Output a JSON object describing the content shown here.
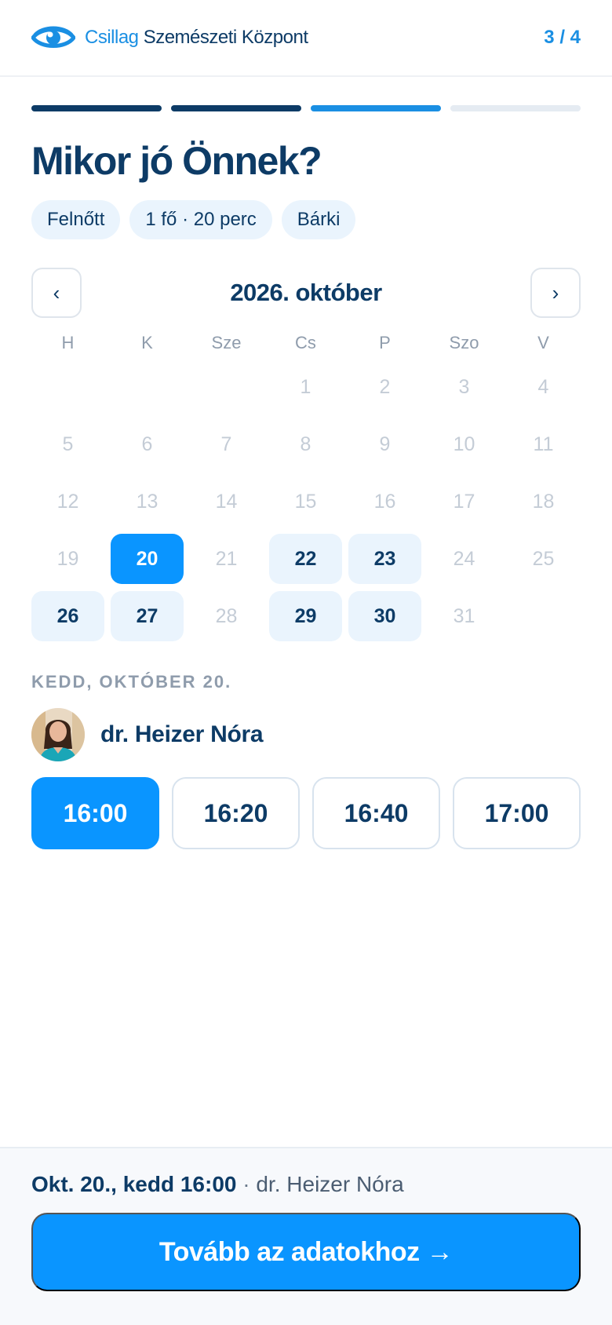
{
  "header": {
    "brand_highlight": "Csillag",
    "brand_rest": "Szemészeti Központ",
    "step": "3 / 4"
  },
  "progress": {
    "total_steps": 4,
    "current_step": 3
  },
  "title": "Mikor jó Önnek?",
  "chips": [
    "Felnőtt",
    "1 fő · 20 perc",
    "Bárki"
  ],
  "calendar": {
    "month_label": "2026. október",
    "prev_icon": "‹",
    "next_icon": "›",
    "weekdays": [
      "H",
      "K",
      "Sze",
      "Cs",
      "P",
      "Szo",
      "V"
    ],
    "leading_empty": 3,
    "days": [
      {
        "d": "1",
        "s": "disabled"
      },
      {
        "d": "2",
        "s": "disabled"
      },
      {
        "d": "3",
        "s": "disabled"
      },
      {
        "d": "4",
        "s": "disabled"
      },
      {
        "d": "5",
        "s": "disabled"
      },
      {
        "d": "6",
        "s": "disabled"
      },
      {
        "d": "7",
        "s": "disabled"
      },
      {
        "d": "8",
        "s": "disabled"
      },
      {
        "d": "9",
        "s": "disabled"
      },
      {
        "d": "10",
        "s": "disabled"
      },
      {
        "d": "11",
        "s": "disabled"
      },
      {
        "d": "12",
        "s": "disabled"
      },
      {
        "d": "13",
        "s": "disabled"
      },
      {
        "d": "14",
        "s": "disabled"
      },
      {
        "d": "15",
        "s": "disabled"
      },
      {
        "d": "16",
        "s": "disabled"
      },
      {
        "d": "17",
        "s": "disabled"
      },
      {
        "d": "18",
        "s": "disabled"
      },
      {
        "d": "19",
        "s": "disabled"
      },
      {
        "d": "20",
        "s": "selected"
      },
      {
        "d": "21",
        "s": "disabled"
      },
      {
        "d": "22",
        "s": "available"
      },
      {
        "d": "23",
        "s": "available"
      },
      {
        "d": "24",
        "s": "disabled"
      },
      {
        "d": "25",
        "s": "disabled"
      },
      {
        "d": "26",
        "s": "available"
      },
      {
        "d": "27",
        "s": "available"
      },
      {
        "d": "28",
        "s": "disabled"
      },
      {
        "d": "29",
        "s": "available"
      },
      {
        "d": "30",
        "s": "available"
      },
      {
        "d": "31",
        "s": "disabled"
      }
    ]
  },
  "selected_date_label": "KEDD, OKTÓBER 20.",
  "doctor": {
    "name": "dr. Heizer Nóra",
    "avatar_icon": "doctor-avatar"
  },
  "slots": [
    {
      "time": "16:00",
      "selected": true
    },
    {
      "time": "16:20",
      "selected": false
    },
    {
      "time": "16:40",
      "selected": false
    },
    {
      "time": "17:00",
      "selected": false
    }
  ],
  "footer": {
    "summary_strong": "Okt. 20., kedd 16:00",
    "summary_sep": " · ",
    "summary_doctor": "dr. Heizer Nóra",
    "cta_label": "Tovább az adatokhoz →"
  },
  "colors": {
    "primary": "#0a95ff",
    "navy": "#0d3b66",
    "accent_blue": "#1a8fe3",
    "chip_bg": "#eaf4fd",
    "muted": "#8f9cac"
  }
}
